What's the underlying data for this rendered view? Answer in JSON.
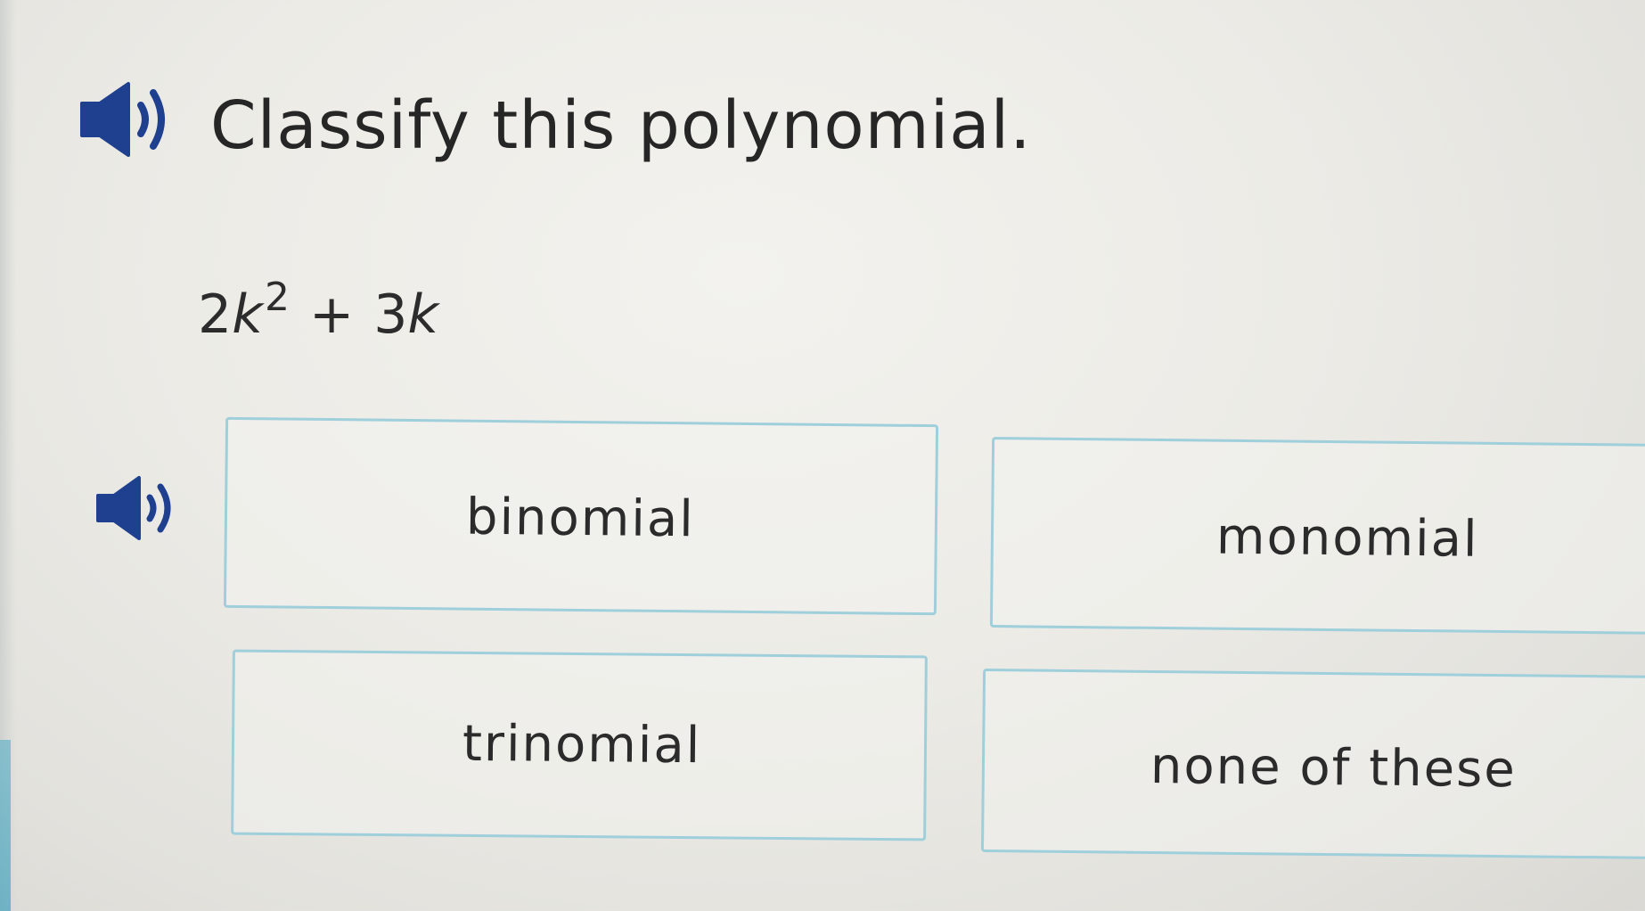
{
  "question": {
    "text": "Classify this polynomial.",
    "audio_icon": "speaker-icon"
  },
  "expression": {
    "coef1": "2",
    "var1": "k",
    "exp1": "2",
    "operator": "+",
    "term2_coef": "3",
    "term2_var": "k"
  },
  "answers": {
    "audio_icon": "speaker-icon",
    "choices": [
      {
        "label": "binomial"
      },
      {
        "label": "monomial"
      },
      {
        "label": "trinomial"
      },
      {
        "label": "none of these"
      }
    ]
  },
  "colors": {
    "choice_border": "#9fcfdb",
    "icon": "#1f3f8f",
    "accent": "#4ea7bf"
  }
}
